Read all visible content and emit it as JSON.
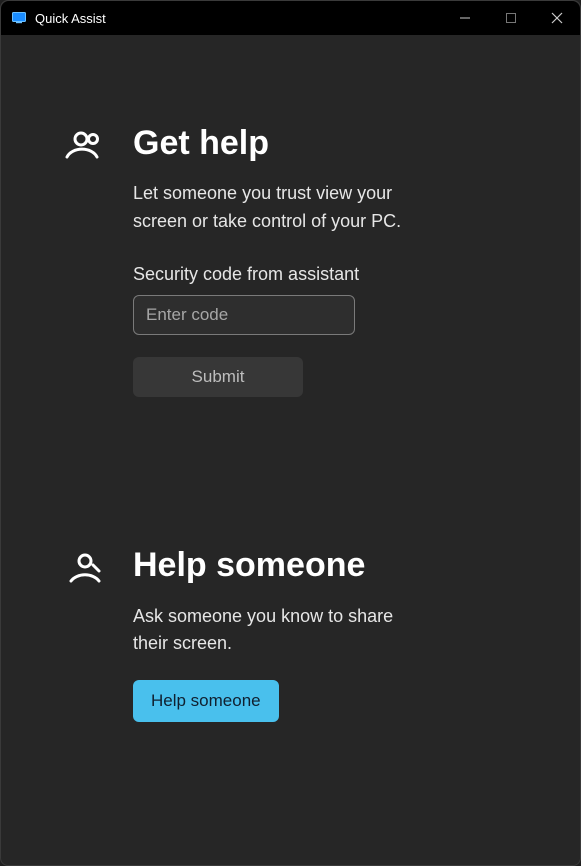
{
  "titlebar": {
    "title": "Quick Assist"
  },
  "getHelp": {
    "heading": "Get help",
    "description": "Let someone you trust view your screen or take control of your PC.",
    "codeLabel": "Security code from assistant",
    "codePlaceholder": "Enter code",
    "submitLabel": "Submit"
  },
  "helpSomeone": {
    "heading": "Help someone",
    "description": "Ask someone you know to share their screen.",
    "buttonLabel": "Help someone"
  }
}
